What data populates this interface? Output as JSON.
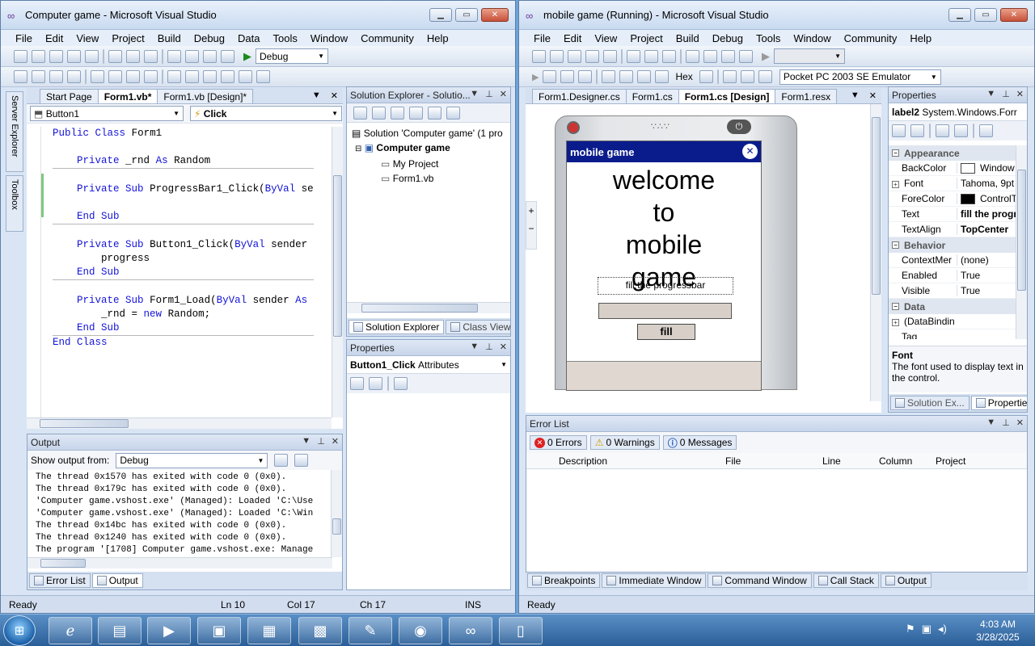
{
  "left_window": {
    "title": "Computer game - Microsoft Visual Studio",
    "menu": [
      "File",
      "Edit",
      "View",
      "Project",
      "Build",
      "Debug",
      "Data",
      "Tools",
      "Window",
      "Community",
      "Help"
    ],
    "config_value": "Debug",
    "editor_tabs": [
      "Start Page",
      "Form1.vb*",
      "Form1.vb [Design]*"
    ],
    "object_combo": "Button1",
    "event_combo": "Click",
    "code_lines": [
      {
        "text": "Public Class Form1"
      },
      {
        "text": ""
      },
      {
        "text": "    Private _rnd As Random"
      },
      {
        "text": ""
      },
      {
        "text": "    Private Sub ProgressBar1_Click(ByVal se"
      },
      {
        "text": ""
      },
      {
        "text": "    End Sub"
      },
      {
        "text": ""
      },
      {
        "text": "    Private Sub Button1_Click(ByVal sender"
      },
      {
        "text": "        progress"
      },
      {
        "text": "    End Sub"
      },
      {
        "text": ""
      },
      {
        "text": "    Private Sub Form1_Load(ByVal sender As"
      },
      {
        "text": "        _rnd = new Random;"
      },
      {
        "text": "    End Sub"
      },
      {
        "text": "End Class"
      }
    ],
    "side_tabs": [
      "Server Explorer",
      "Toolbox"
    ],
    "solution_explorer": {
      "title": "Solution Explorer - Solutio...",
      "solution": "Solution 'Computer game' (1 pro",
      "project": "Computer game",
      "items": [
        "My Project",
        "Form1.vb"
      ],
      "tabs": [
        "Solution Explorer",
        "Class View"
      ]
    },
    "properties": {
      "title": "Properties",
      "object_name": "Button1_Click",
      "object_type": "Attributes"
    },
    "output": {
      "title": "Output",
      "show_from_label": "Show output from:",
      "show_from_value": "Debug",
      "lines": [
        "The thread 0x1570 has exited with code 0 (0x0).",
        "The thread 0x179c has exited with code 0 (0x0).",
        "'Computer game.vshost.exe' (Managed): Loaded 'C:\\Use",
        "'Computer game.vshost.exe' (Managed): Loaded 'C:\\Win",
        "The thread 0x14bc has exited with code 0 (0x0).",
        "The thread 0x1240 has exited with code 0 (0x0).",
        "The program '[1708] Computer game.vshost.exe: Manage"
      ],
      "tabs": [
        "Error List",
        "Output"
      ]
    },
    "status": {
      "ready": "Ready",
      "ln": "Ln 10",
      "col": "Col 17",
      "ch": "Ch 17",
      "mode": "INS"
    }
  },
  "right_window": {
    "title": "mobile game (Running) - Microsoft Visual Studio",
    "menu": [
      "File",
      "Edit",
      "View",
      "Project",
      "Build",
      "Debug",
      "Tools",
      "Window",
      "Community",
      "Help"
    ],
    "hex_label": "Hex",
    "device_combo": "Pocket PC 2003 SE Emulator",
    "editor_tabs": [
      "Form1.Designer.cs",
      "Form1.cs",
      "Form1.cs [Design]",
      "Form1.resx"
    ],
    "device": {
      "form_title": "mobile game",
      "welcome_lines": [
        "welcome",
        "to",
        "mobile",
        "game"
      ],
      "label": "fill the progressbar",
      "button": "fill"
    },
    "properties": {
      "title": "Properties",
      "object_name": "label2",
      "object_type": "System.Windows.Forr",
      "categories": [
        {
          "name": "Appearance",
          "rows": [
            {
              "name": "BackColor",
              "value": "Window",
              "swatch": "#ffffff"
            },
            {
              "name": "Font",
              "value": "Tahoma, 9pt",
              "expand": true
            },
            {
              "name": "ForeColor",
              "value": "ControlT",
              "swatch": "#000000"
            },
            {
              "name": "Text",
              "value": "fill the progr",
              "bold": true
            },
            {
              "name": "TextAlign",
              "value": "TopCenter",
              "bold": true
            }
          ]
        },
        {
          "name": "Behavior",
          "rows": [
            {
              "name": "ContextMer",
              "value": "(none)"
            },
            {
              "name": "Enabled",
              "value": "True"
            },
            {
              "name": "Visible",
              "value": "True"
            }
          ]
        },
        {
          "name": "Data",
          "rows": [
            {
              "name": "(DataBindin",
              "value": "",
              "expand": true
            },
            {
              "name": "Tag",
              "value": ""
            }
          ]
        }
      ],
      "desc_title": "Font",
      "desc_text": "The font used to display text in the control.",
      "tabs": [
        "Solution Ex...",
        "Properties"
      ]
    },
    "error_list": {
      "title": "Error List",
      "filters": [
        "0 Errors",
        "0 Warnings",
        "0 Messages"
      ],
      "columns": [
        "Description",
        "File",
        "Line",
        "Column",
        "Project"
      ]
    },
    "bottom_tabs": [
      "Breakpoints",
      "Immediate Window",
      "Command Window",
      "Call Stack",
      "Output"
    ],
    "status": "Ready"
  },
  "taskbar": {
    "time": "4:03 AM",
    "date": "3/28/2025"
  },
  "colors": {
    "keyword": "#1414d8",
    "form_title_bar": "#0a1c8c",
    "desktop": "#6aa3d8"
  }
}
